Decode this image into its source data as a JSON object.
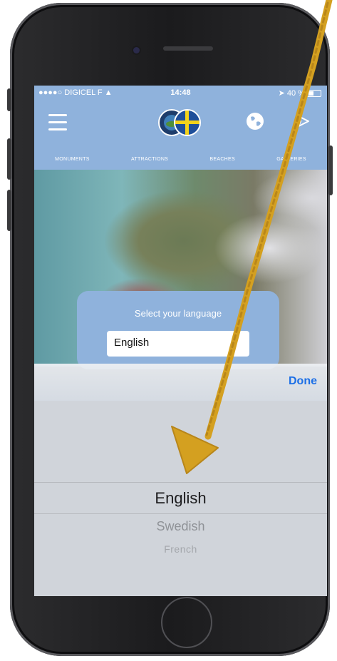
{
  "status_bar": {
    "carrier": "●●●●○ DIGICEL F",
    "time": "14:48",
    "battery": "40 %"
  },
  "header": {
    "menu_icon": "hamburger-menu-icon",
    "logo_icon": "app-logo-icon",
    "globe_icon": "globe-icon",
    "share_icon": "share-icon"
  },
  "category_nav": {
    "items": [
      "MONUMENTS",
      "ATTRACTIONS",
      "BEACHES",
      "GALLERIES"
    ]
  },
  "language_modal": {
    "title": "Select your language",
    "selected_value": "English"
  },
  "picker": {
    "done_label": "Done",
    "options": [
      "English",
      "Swedish",
      "French"
    ],
    "selected_index": 0
  },
  "colors": {
    "app_bar": "#8fb2dc",
    "done_blue": "#1c6fe6",
    "annotation_arrow": "#d4a020"
  }
}
